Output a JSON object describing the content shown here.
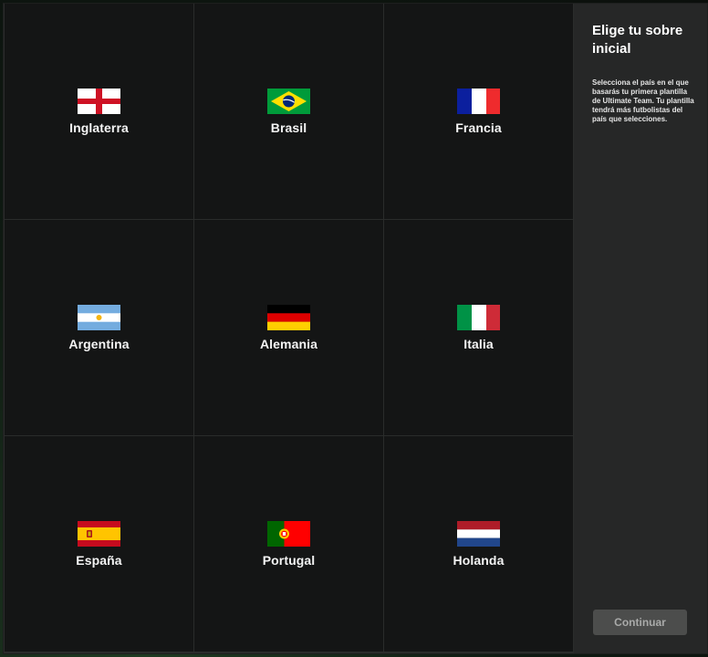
{
  "countries": [
    {
      "label": "Inglaterra",
      "icon": "england-flag-icon"
    },
    {
      "label": "Brasil",
      "icon": "brazil-flag-icon"
    },
    {
      "label": "Francia",
      "icon": "france-flag-icon"
    },
    {
      "label": "Argentina",
      "icon": "argentina-flag-icon"
    },
    {
      "label": "Alemania",
      "icon": "germany-flag-icon"
    },
    {
      "label": "Italia",
      "icon": "italy-flag-icon"
    },
    {
      "label": "España",
      "icon": "spain-flag-icon"
    },
    {
      "label": "Portugal",
      "icon": "portugal-flag-icon"
    },
    {
      "label": "Holanda",
      "icon": "netherlands-flag-icon"
    }
  ],
  "sidebar": {
    "title": "Elige tu sobre inicial",
    "description": "Selecciona el país en el que basarás tu primera plantilla de Ultimate Team. Tu plantilla tendrá más futbolistas del país que selecciones.",
    "continue_label": "Continuar"
  },
  "colors": {
    "panel": "#141515",
    "sidebar": "#262727",
    "button_disabled": "#4c4d4c"
  }
}
